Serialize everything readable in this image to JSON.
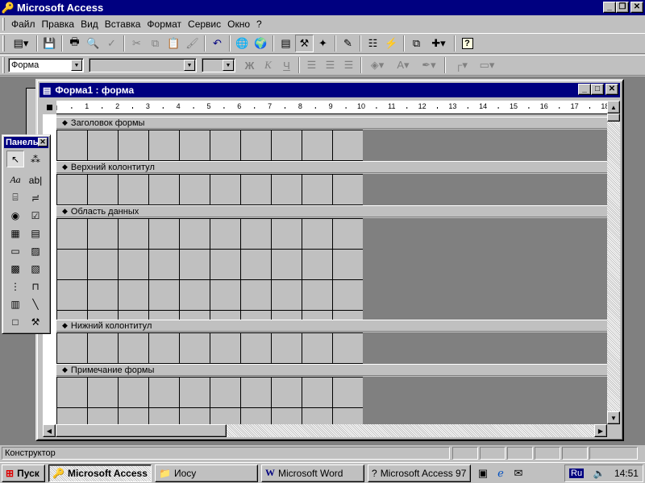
{
  "app": {
    "title": "Microsoft Access"
  },
  "menu": [
    "Файл",
    "Правка",
    "Вид",
    "Вставка",
    "Формат",
    "Сервис",
    "Окно",
    "?"
  ],
  "format_toolbar": {
    "object_combo": "Форма",
    "font_combo": "",
    "size_combo": "",
    "bold_label": "Ж",
    "italic_label": "К",
    "underline_label": "Ч"
  },
  "form_window": {
    "title": "Форма1 : форма",
    "ruler_labels": [
      "1",
      "2",
      "3",
      "4",
      "5",
      "6",
      "7",
      "8",
      "9",
      "10",
      "11",
      "12",
      "13",
      "14",
      "15",
      "16",
      "17",
      "18"
    ],
    "sections": [
      "Заголовок формы",
      "Верхний колонтитул",
      "Область данных",
      "Нижний колонтитул",
      "Примечание формы"
    ]
  },
  "toolbox": {
    "title": "Панель",
    "tools": [
      {
        "name": "select-tool-icon",
        "glyph": "↖"
      },
      {
        "name": "wizard-tool-icon",
        "glyph": "⁂"
      },
      {
        "name": "label-tool-icon",
        "glyph": "Aa"
      },
      {
        "name": "textbox-tool-icon",
        "glyph": "ab|"
      },
      {
        "name": "option-group-tool-icon",
        "glyph": "⌸"
      },
      {
        "name": "toggle-button-tool-icon",
        "glyph": "≓"
      },
      {
        "name": "option-button-tool-icon",
        "glyph": "◉"
      },
      {
        "name": "checkbox-tool-icon",
        "glyph": "☑"
      },
      {
        "name": "combobox-tool-icon",
        "glyph": "▦"
      },
      {
        "name": "listbox-tool-icon",
        "glyph": "▤"
      },
      {
        "name": "command-button-tool-icon",
        "glyph": "▭"
      },
      {
        "name": "image-tool-icon",
        "glyph": "▨"
      },
      {
        "name": "unbound-object-tool-icon",
        "glyph": "▩"
      },
      {
        "name": "bound-object-tool-icon",
        "glyph": "▧"
      },
      {
        "name": "page-break-tool-icon",
        "glyph": "⋮"
      },
      {
        "name": "tab-control-tool-icon",
        "glyph": "⊓"
      },
      {
        "name": "subform-tool-icon",
        "glyph": "▥"
      },
      {
        "name": "line-tool-icon",
        "glyph": "╲"
      },
      {
        "name": "rectangle-tool-icon",
        "glyph": "□"
      },
      {
        "name": "more-controls-tool-icon",
        "glyph": "⚒"
      }
    ]
  },
  "status": {
    "mode": "Конструктор"
  },
  "taskbar": {
    "start": "Пуск",
    "items": [
      {
        "label": "Microsoft Access",
        "active": true,
        "icon": "key-icon"
      },
      {
        "label": "Иосу",
        "active": false,
        "icon": "folder-icon"
      },
      {
        "label": "Microsoft Word",
        "active": false,
        "icon": "word-icon"
      },
      {
        "label": "Microsoft Access 97",
        "active": false,
        "icon": "help-book-icon"
      }
    ],
    "lang": "Ru",
    "clock": "14:51"
  },
  "colors": {
    "title_active": "#000080",
    "face": "#c0c0c0",
    "mdi_bg": "#808080"
  }
}
